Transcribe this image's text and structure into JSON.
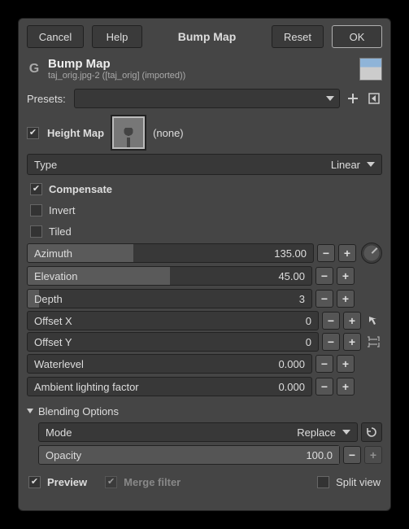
{
  "titlebar": {
    "cancel": "Cancel",
    "help": "Help",
    "title": "Bump Map",
    "reset": "Reset",
    "ok": "OK"
  },
  "header": {
    "title": "Bump Map",
    "subtitle": "taj_orig.jpg-2 ([taj_orig] (imported))"
  },
  "presets": {
    "label": "Presets:"
  },
  "heightmap": {
    "checked": true,
    "label": "Height Map",
    "value": "(none)"
  },
  "type": {
    "label": "Type",
    "value": "Linear"
  },
  "checks": {
    "compensate": {
      "checked": true,
      "label": "Compensate"
    },
    "invert": {
      "checked": false,
      "label": "Invert"
    },
    "tiled": {
      "checked": false,
      "label": "Tiled"
    }
  },
  "sliders": {
    "azimuth": {
      "label": "Azimuth",
      "value": "135.00",
      "fill": 37
    },
    "elevation": {
      "label": "Elevation",
      "value": "45.00",
      "fill": 50
    },
    "depth": {
      "label": "Depth",
      "value": "3",
      "fill": 4
    },
    "offsetx": {
      "label": "Offset X",
      "value": "0",
      "fill": 0
    },
    "offsety": {
      "label": "Offset Y",
      "value": "0",
      "fill": 0
    },
    "waterlevel": {
      "label": "Waterlevel",
      "value": "0.000",
      "fill": 0
    },
    "ambient": {
      "label": "Ambient lighting factor",
      "value": "0.000",
      "fill": 0
    }
  },
  "blending": {
    "header": "Blending Options",
    "mode_label": "Mode",
    "mode_value": "Replace",
    "opacity_label": "Opacity",
    "opacity_value": "100.0"
  },
  "footer": {
    "preview": {
      "checked": true,
      "label": "Preview"
    },
    "merge": {
      "checked": true,
      "label": "Merge filter",
      "disabled": true
    },
    "split": {
      "checked": false,
      "label": "Split view"
    }
  }
}
